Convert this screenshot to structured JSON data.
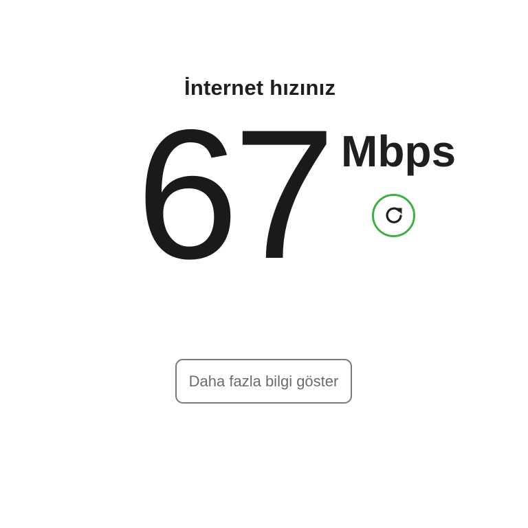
{
  "speed_test": {
    "title": "İnternet hızınız",
    "value": "67",
    "unit": "Mbps",
    "refresh_icon": "refresh-icon"
  },
  "more_info_button": {
    "label": "Daha fazla bilgi göster"
  },
  "colors": {
    "accent": "#3cb043",
    "text": "#1f1f1f",
    "button_border": "#7a7a7a",
    "button_text": "#6b6b6b"
  }
}
